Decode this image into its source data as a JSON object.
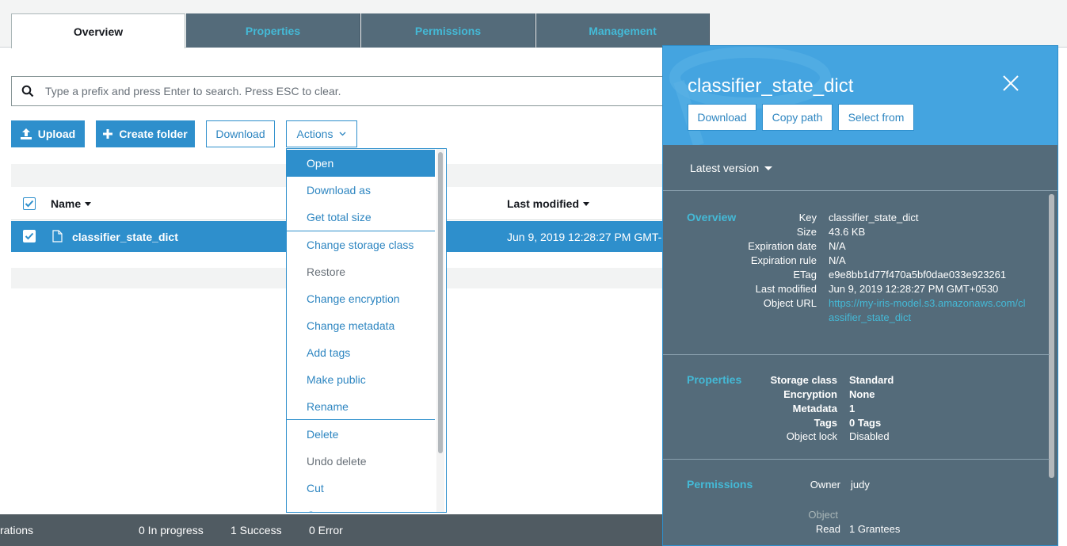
{
  "tabs": [
    {
      "label": "Overview"
    },
    {
      "label": "Properties"
    },
    {
      "label": "Permissions"
    },
    {
      "label": "Management"
    }
  ],
  "search": {
    "placeholder": "Type a prefix and press Enter to search. Press ESC to clear."
  },
  "toolbar": {
    "upload_label": "Upload",
    "create_folder_label": "Create folder",
    "download_label": "Download",
    "actions_label": "Actions"
  },
  "table": {
    "columns": {
      "name": "Name",
      "last_modified": "Last modified"
    },
    "rows": [
      {
        "name": "classifier_state_dict",
        "last_modified": "Jun 9, 2019 12:28:27 PM GMT-"
      }
    ]
  },
  "actions_menu": {
    "items": [
      {
        "label": "Open"
      },
      {
        "label": "Download as"
      },
      {
        "label": "Get total size"
      },
      {
        "label": "Change storage class"
      },
      {
        "label": "Restore"
      },
      {
        "label": "Change encryption"
      },
      {
        "label": "Change metadata"
      },
      {
        "label": "Add tags"
      },
      {
        "label": "Make public"
      },
      {
        "label": "Rename"
      },
      {
        "label": "Delete"
      },
      {
        "label": "Undo delete"
      },
      {
        "label": "Cut"
      },
      {
        "label": "Copy"
      }
    ]
  },
  "footer": {
    "operations": "rations",
    "in_progress": "0 In progress",
    "success": "1 Success",
    "error": "0 Error"
  },
  "panel": {
    "title": "classifier_state_dict",
    "buttons": {
      "download": "Download",
      "copy_path": "Copy path",
      "select_from": "Select from"
    },
    "version_label": "Latest version",
    "overview": {
      "title": "Overview",
      "key_label": "Key",
      "key": "classifier_state_dict",
      "size_label": "Size",
      "size": "43.6 KB",
      "expiration_date_label": "Expiration date",
      "expiration_date": "N/A",
      "expiration_rule_label": "Expiration rule",
      "expiration_rule": "N/A",
      "etag_label": "ETag",
      "etag": "e9e8bb1d77f470a5bf0dae033e923261",
      "last_modified_label": "Last modified",
      "last_modified": "Jun 9, 2019 12:28:27 PM GMT+0530",
      "object_url_label": "Object URL",
      "object_url": "https://my-iris-model.s3.amazonaws.com/classifier_state_dict"
    },
    "properties": {
      "title": "Properties",
      "storage_class_label": "Storage class",
      "storage_class": "Standard",
      "encryption_label": "Encryption",
      "encryption": "None",
      "metadata_label": "Metadata",
      "metadata": "1",
      "tags_label": "Tags",
      "tags": "0 Tags",
      "object_lock_label": "Object lock",
      "object_lock": "Disabled"
    },
    "permissions": {
      "title": "Permissions",
      "owner_label": "Owner",
      "owner": "judy",
      "object_label": "Object",
      "read_label": "Read",
      "read": "1 Grantees"
    }
  },
  "colors": {
    "accent": "#2e8fcc",
    "panel_bg": "#546b7a",
    "panel_header": "#44a4e0",
    "link": "#44b9d6"
  }
}
